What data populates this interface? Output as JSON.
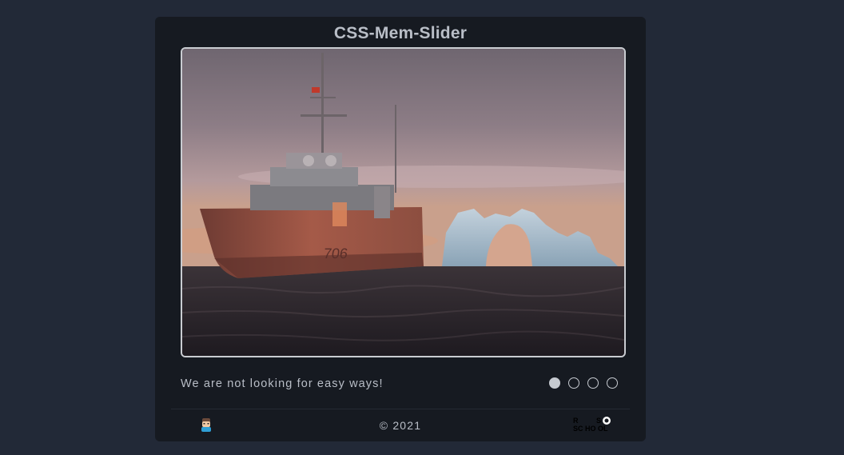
{
  "app": {
    "title": "CSS-Mem-Slider"
  },
  "slider": {
    "image_alt": "Warship sailing near an arched iceberg at dusk",
    "caption": "We are not looking for easy ways!",
    "total_slides": 4,
    "active_slide": 1,
    "dot_labels": [
      "slide-1",
      "slide-2",
      "slide-3",
      "slide-4"
    ]
  },
  "footer": {
    "avatar_icon": "github-avatar-icon",
    "copyright": "© 2021",
    "logo_text": "RS SCHOOL",
    "logo_icon": "rs-school-logo"
  },
  "colors": {
    "background": "#222937",
    "card": "#161a21",
    "text": "#b9bec7",
    "frame_border": "#c9ccd1"
  }
}
